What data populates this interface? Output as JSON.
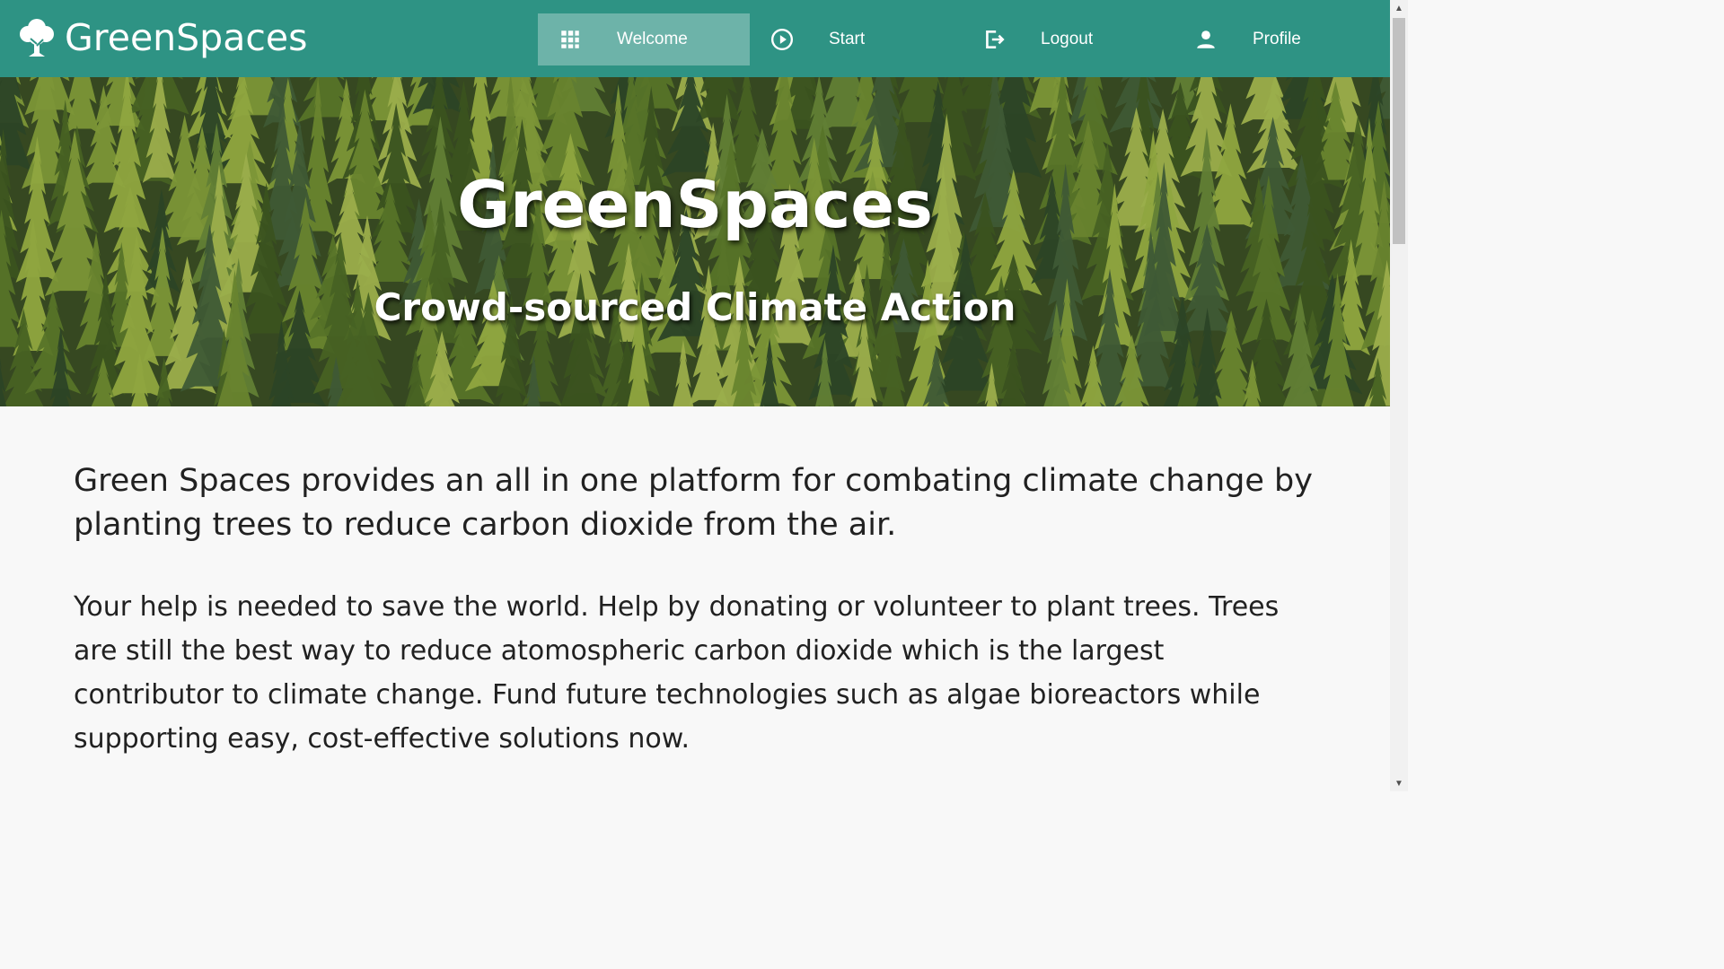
{
  "navbar": {
    "brand": "GreenSpaces",
    "items": [
      {
        "label": "Welcome",
        "icon": "grid-icon",
        "active": true
      },
      {
        "label": "Start",
        "icon": "play-circle-icon",
        "active": false
      },
      {
        "label": "Logout",
        "icon": "logout-icon",
        "active": false
      },
      {
        "label": "Profile",
        "icon": "user-icon",
        "active": false
      }
    ]
  },
  "hero": {
    "title": "GreenSpaces",
    "subtitle": "Crowd-sourced Climate Action"
  },
  "content": {
    "lead": "Green Spaces provides an all in one platform for combating climate change by planting trees to reduce carbon dioxide from the air.",
    "paragraph": "Your help is needed to save the world. Help by donating or volunteer to plant trees. Trees are still the best way to reduce atomospheric carbon dioxide which is the largest contributor to climate change. Fund future technologies such as algae bioreactors while supporting easy, cost-effective solutions now."
  },
  "colors": {
    "navbar": "#2e9384",
    "active_item": "#6cb5aa",
    "text": "#212121",
    "background": "#f8f8f8"
  }
}
